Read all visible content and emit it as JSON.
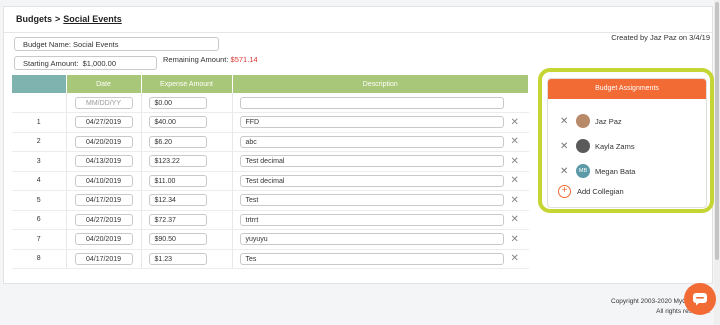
{
  "breadcrumb": {
    "parent": "Budgets",
    "separator": ">",
    "current": "Social Events"
  },
  "budget": {
    "name_label": "Budget Name:",
    "name": "Social Events",
    "starting_label": "Starting Amount:",
    "starting": "$1,000.00",
    "remaining_label": "Remaining Amount:",
    "remaining": "$571.14",
    "created_by": "Created by Jaz Paz on 3/4/19"
  },
  "table": {
    "headers": [
      "",
      "Date",
      "Expense Amount",
      "Description"
    ],
    "new_row": {
      "date_placeholder": "MM/DD/YY",
      "amount": "$0.00",
      "description": ""
    },
    "rows": [
      {
        "num": "1",
        "date": "04/27/2019",
        "amount": "$40.00",
        "description": "FFD"
      },
      {
        "num": "2",
        "date": "04/20/2019",
        "amount": "$6.20",
        "description": "abc"
      },
      {
        "num": "3",
        "date": "04/13/2019",
        "amount": "$123.22",
        "description": "Test decimal"
      },
      {
        "num": "4",
        "date": "04/10/2019",
        "amount": "$11.00",
        "description": "Test decimal"
      },
      {
        "num": "5",
        "date": "04/17/2019",
        "amount": "$12.34",
        "description": "Test"
      },
      {
        "num": "6",
        "date": "04/27/2019",
        "amount": "$72.37",
        "description": "trtrrt"
      },
      {
        "num": "7",
        "date": "04/20/2019",
        "amount": "$90.50",
        "description": "yuyuyu"
      },
      {
        "num": "8",
        "date": "04/17/2019",
        "amount": "$1.23",
        "description": "Tes"
      }
    ]
  },
  "assignments": {
    "title": "Budget Assignments",
    "members": [
      {
        "name": "Jaz Paz",
        "initials": ""
      },
      {
        "name": "Kayla Zams",
        "initials": ""
      },
      {
        "name": "Megan Bata",
        "initials": "MB"
      }
    ],
    "add_label": "Add Collegian"
  },
  "footer": {
    "line1": "Copyright 2003-2020 MyChapterR",
    "line2": "All rights reserved."
  },
  "colors": {
    "accent": "#f26b35",
    "header_green": "#a9c778",
    "header_teal": "#7fb3b0",
    "highlight": "#c5d534",
    "negative": "#d9352e"
  }
}
